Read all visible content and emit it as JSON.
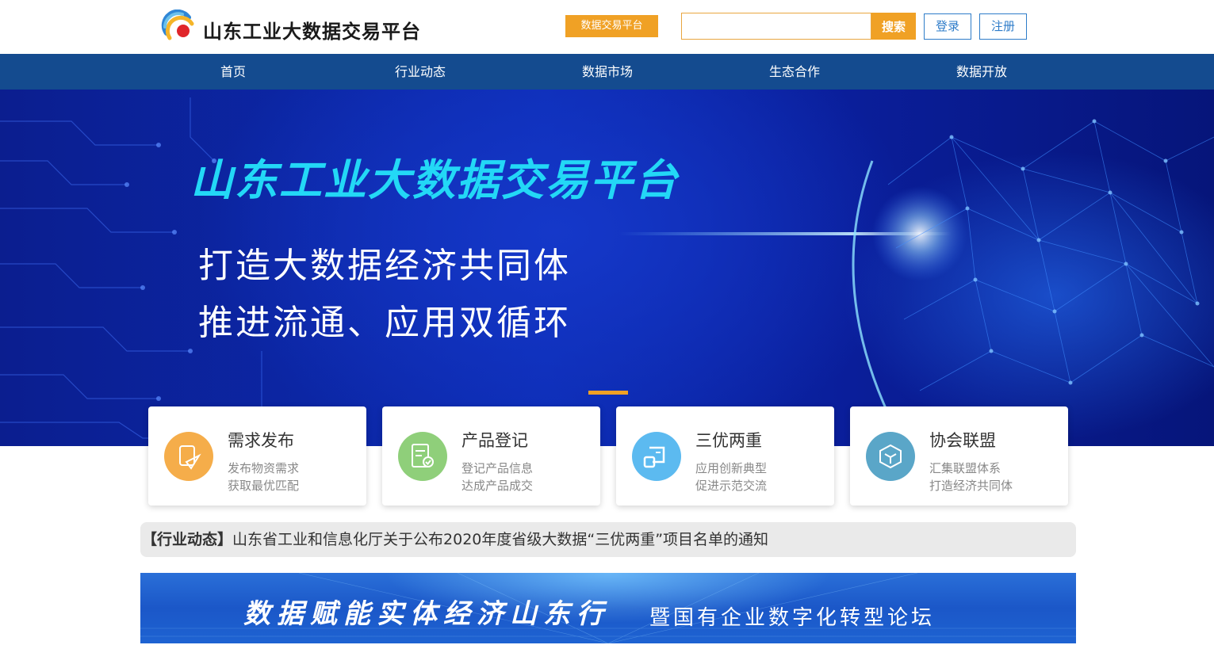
{
  "header": {
    "brand": "山东工业大数据交易平台",
    "platform_badge": "数据交易平台",
    "search_placeholder": "",
    "search_button": "搜索",
    "login": "登录",
    "register": "注册"
  },
  "nav": {
    "items": [
      {
        "label": "首页"
      },
      {
        "label": "行业动态"
      },
      {
        "label": "数据市场"
      },
      {
        "label": "生态合作"
      },
      {
        "label": "数据开放"
      }
    ]
  },
  "banner": {
    "title": "山东工业大数据交易平台",
    "line1": "打造大数据经济共同体",
    "line2": "推进流通、应用双循环",
    "carousel_position": 1
  },
  "cards": [
    {
      "title": "需求发布",
      "sub1": "发布物资需求",
      "sub2": "获取最优匹配",
      "color": "#f5ad4a",
      "icon": "send-icon"
    },
    {
      "title": "产品登记",
      "sub1": "登记产品信息",
      "sub2": "达成产品成交",
      "color": "#8fcf7a",
      "icon": "document-check-icon"
    },
    {
      "title": "三优两重",
      "sub1": "应用创新典型",
      "sub2": "促进示范交流",
      "color": "#5cbaf0",
      "icon": "scroll-icon"
    },
    {
      "title": "协会联盟",
      "sub1": "汇集联盟体系",
      "sub2": "打造经济共同体",
      "color": "#5aa6c8",
      "icon": "cube-icon"
    }
  ],
  "news": {
    "tag": "【行业动态】",
    "text": "山东省工业和信息化厅关于公布2020年度省级大数据“三优两重”项目名单的通知"
  },
  "forum": {
    "main": "数据赋能实体经济山东行",
    "sub": "暨国有企业数字化转型论坛"
  },
  "colors": {
    "accent": "#f0a125",
    "nav_bg": "#144b8f",
    "link_blue": "#2e7cc9",
    "banner_title": "#23d8f6"
  }
}
